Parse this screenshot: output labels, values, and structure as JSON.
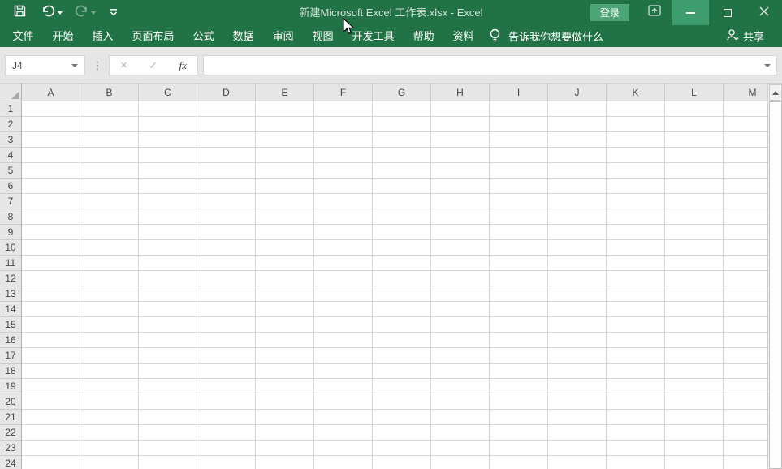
{
  "window": {
    "title": "新建Microsoft Excel 工作表.xlsx  -  Excel",
    "signin_label": "登录",
    "controls": {
      "minimize": "minimize",
      "maximize": "maximize",
      "close": "close",
      "ribbon_display_options": "ribbon-display-options"
    }
  },
  "colors": {
    "titlebar_green": "#217346",
    "signin_green": "#4da476",
    "minimize_highlight_green": "#3f9c6c",
    "formula_bar_gray": "#e6e6e6",
    "header_gray": "#e6e6e6",
    "gridline": "#d7d7d7"
  },
  "quick_access": {
    "icons": [
      "save-icon",
      "undo-icon",
      "redo-icon",
      "customize-quick-access-icon"
    ]
  },
  "menubar": {
    "tabs": [
      "文件",
      "开始",
      "插入",
      "页面布局",
      "公式",
      "数据",
      "审阅",
      "视图",
      "开发工具",
      "帮助",
      "资料"
    ],
    "tab_names": [
      "file",
      "home",
      "insert",
      "page-layout",
      "formulas",
      "data",
      "review",
      "view",
      "developer",
      "help",
      "ziliao"
    ],
    "tellme_label": "告诉我你想要做什么",
    "tellme_icon": "lightbulb-icon",
    "share_label": "共享",
    "share_icon": "person-add-icon"
  },
  "formula_bar": {
    "name_box_value": "J4",
    "cancel_icon": "×",
    "enter_icon": "✓",
    "insert_function_label": "fx",
    "formula_value": "",
    "separator_dots": "⋮"
  },
  "sheet": {
    "columns": [
      "A",
      "B",
      "C",
      "D",
      "E",
      "F",
      "G",
      "H",
      "I",
      "J",
      "K",
      "L",
      "M"
    ],
    "rows": [
      "1",
      "2",
      "3",
      "4",
      "5",
      "6",
      "7",
      "8",
      "9",
      "10",
      "11",
      "12",
      "13",
      "14",
      "15",
      "16",
      "17",
      "18",
      "19",
      "20",
      "21",
      "22",
      "23",
      "24"
    ]
  }
}
